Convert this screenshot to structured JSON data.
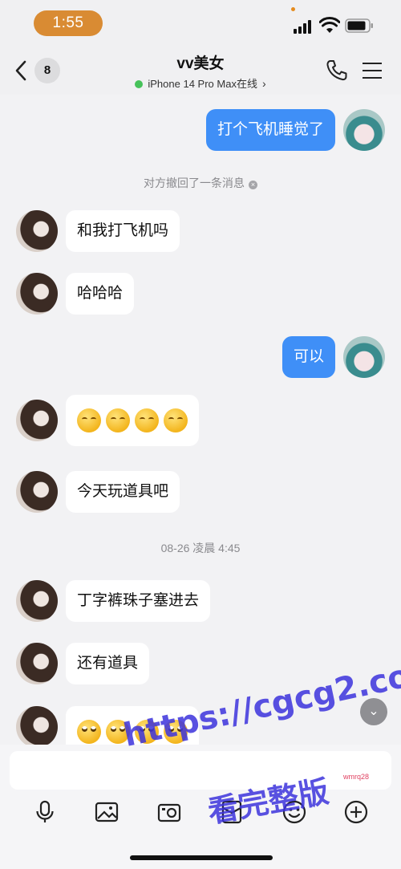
{
  "status_bar": {
    "time": "1:55"
  },
  "header": {
    "unread_count": "8",
    "contact_name": "vv美女",
    "online_status": "iPhone 14 Pro Max在线"
  },
  "messages": {
    "m1": "打个飞机睡觉了",
    "revoke_note": "对方撤回了一条消息",
    "m2": "和我打飞机吗",
    "m3": "哈哈哈",
    "m4": "可以",
    "m6": "今天玩道具吧",
    "timestamp": "08-26 凌晨 4:45",
    "m7": "丁字裤珠子塞进去",
    "m8": "还有道具"
  },
  "watermark": {
    "url": "https://cgcg2.co",
    "text": "看完整版",
    "small": "wmrq28"
  },
  "colors": {
    "bubble_out": "#3f8ff7",
    "bubble_in": "#ffffff",
    "online_dot": "#46c25a",
    "time_pill": "#d98b33"
  }
}
